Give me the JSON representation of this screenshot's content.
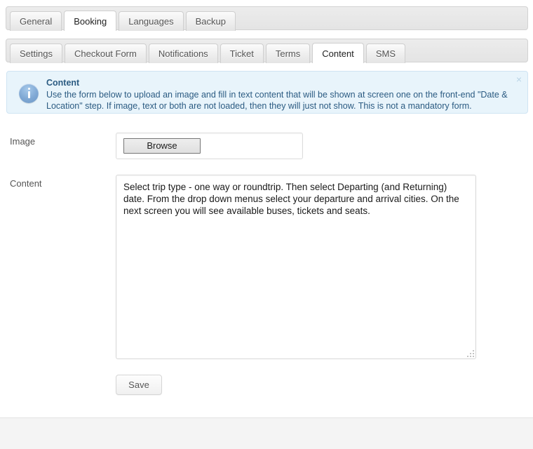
{
  "primary_tabs": {
    "items": [
      {
        "label": "General",
        "active": false
      },
      {
        "label": "Booking",
        "active": true
      },
      {
        "label": "Languages",
        "active": false
      },
      {
        "label": "Backup",
        "active": false
      }
    ]
  },
  "secondary_tabs": {
    "items": [
      {
        "label": "Settings",
        "active": false
      },
      {
        "label": "Checkout Form",
        "active": false
      },
      {
        "label": "Notifications",
        "active": false
      },
      {
        "label": "Ticket",
        "active": false
      },
      {
        "label": "Terms",
        "active": false
      },
      {
        "label": "Content",
        "active": true
      },
      {
        "label": "SMS",
        "active": false
      }
    ]
  },
  "alert": {
    "icon": "info-icon",
    "title": "Content",
    "message": "Use the form below to upload an image and fill in text content that will be shown at screen one on the front-end \"Date & Location\" step. If image, text or both are not loaded, then they will just not show. This is not a mandatory form.",
    "close_label": "×",
    "background_color": "#e8f4fb",
    "border_color": "#cfe4f3",
    "text_color": "#2b5b82"
  },
  "form": {
    "image_field": {
      "label": "Image",
      "browse_label": "Browse",
      "filename": ""
    },
    "content_field": {
      "label": "Content",
      "value": "Select trip type - one way or roundtrip. Then select Departing (and Returning) date. From the drop down menus select your departure and arrival cities. On the next screen you will see available buses, tickets and seats.",
      "placeholder": ""
    },
    "save_label": "Save"
  }
}
